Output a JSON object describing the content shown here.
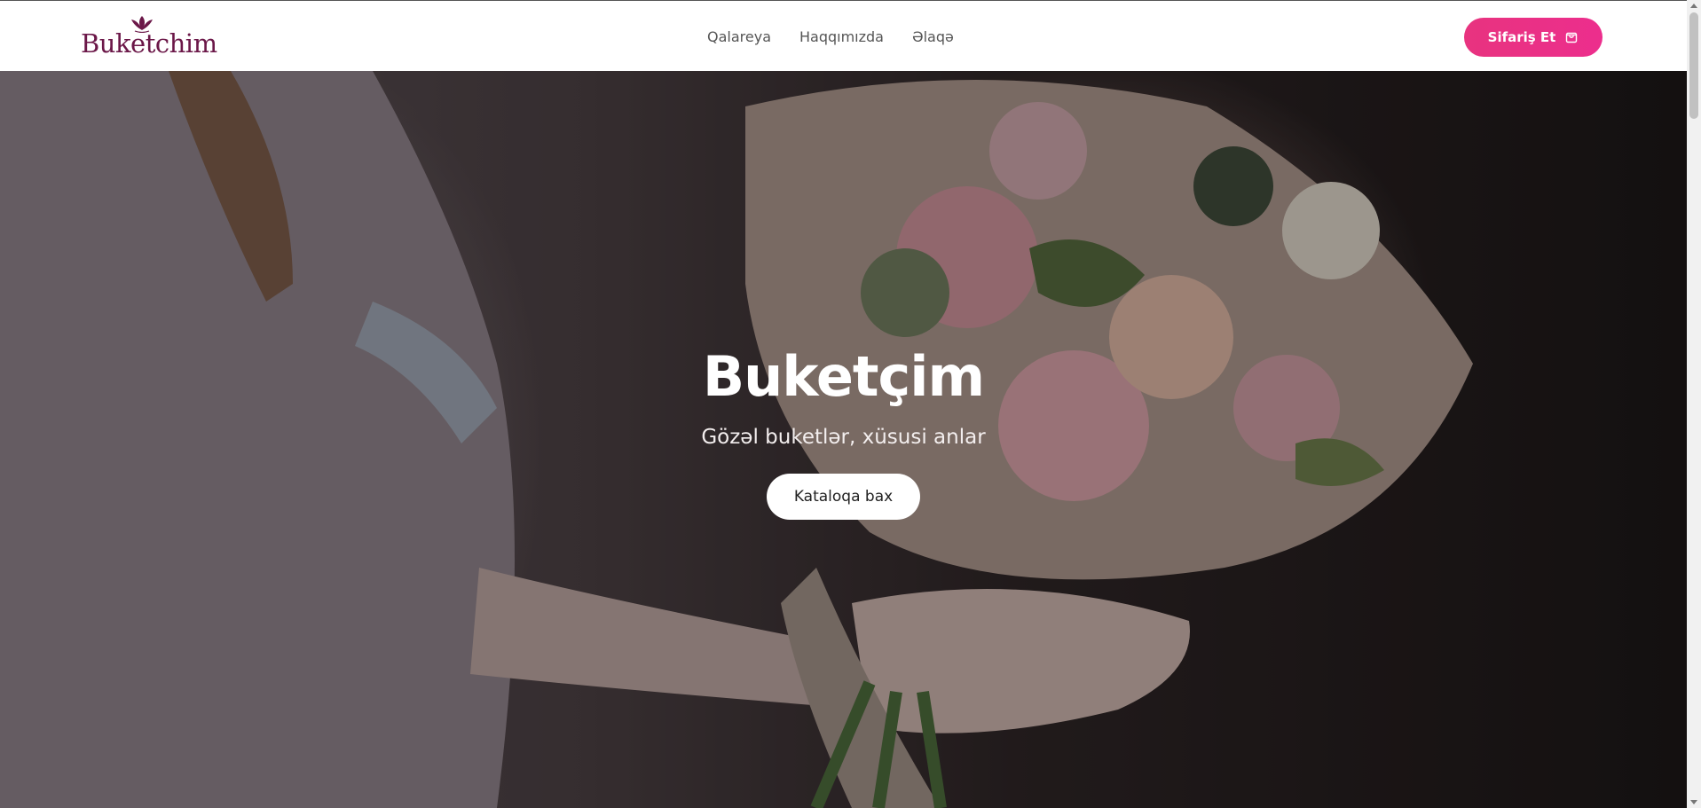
{
  "brand": {
    "name": "Buketchim",
    "logo_icon": "lotus-flower-icon",
    "color": "#6b1748"
  },
  "nav": {
    "items": [
      "Qalareya",
      "Haqqımızda",
      "Əlaqə"
    ]
  },
  "order_button": {
    "label": "Sifariş Et",
    "icon": "shopping-bag-icon",
    "color": "#e8337f"
  },
  "hero": {
    "title": "Buketçim",
    "subtitle": "Gözəl buketlər, xüsusi anlar",
    "cta_label": "Kataloqa bax",
    "image": "florist-holding-flower-bouquet"
  }
}
